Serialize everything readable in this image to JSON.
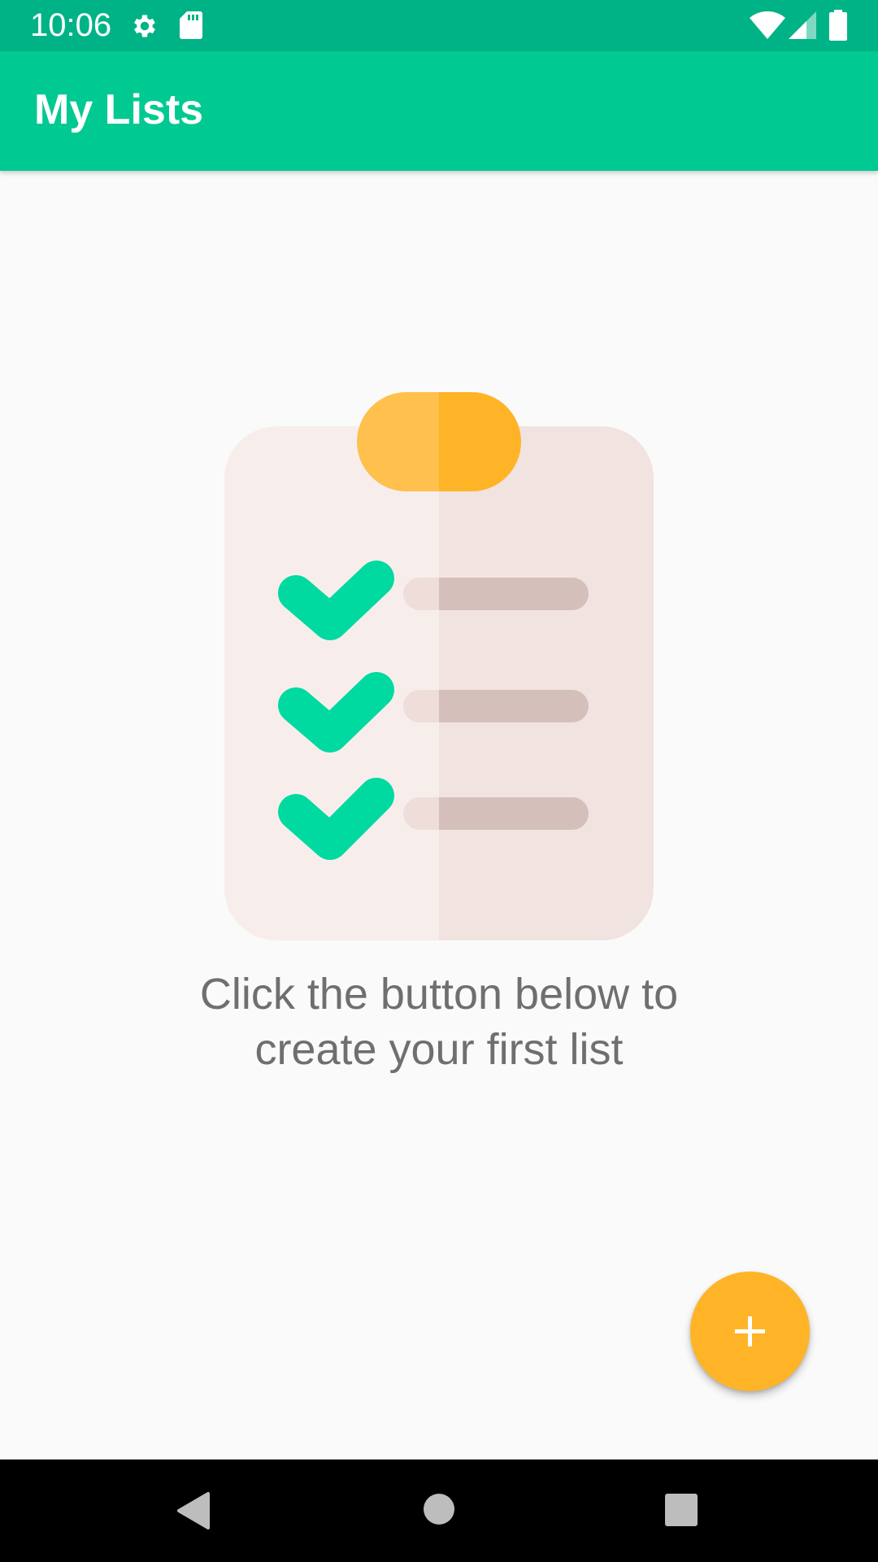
{
  "status_bar": {
    "time": "10:06",
    "icons": [
      "gear-icon",
      "sd-card-icon",
      "wifi-icon",
      "signal-icon",
      "battery-icon"
    ],
    "background": "#00B386"
  },
  "app_bar": {
    "title": "My Lists",
    "background": "#00C992"
  },
  "empty_state": {
    "illustration": "clipboard-checklist-icon",
    "message_line1": "Click the button below to",
    "message_line2": "create your first list"
  },
  "fab": {
    "icon": "plus-icon",
    "color": "#FFB427"
  },
  "navigation_bar": {
    "buttons": [
      "back-icon",
      "home-icon",
      "recents-icon"
    ]
  }
}
